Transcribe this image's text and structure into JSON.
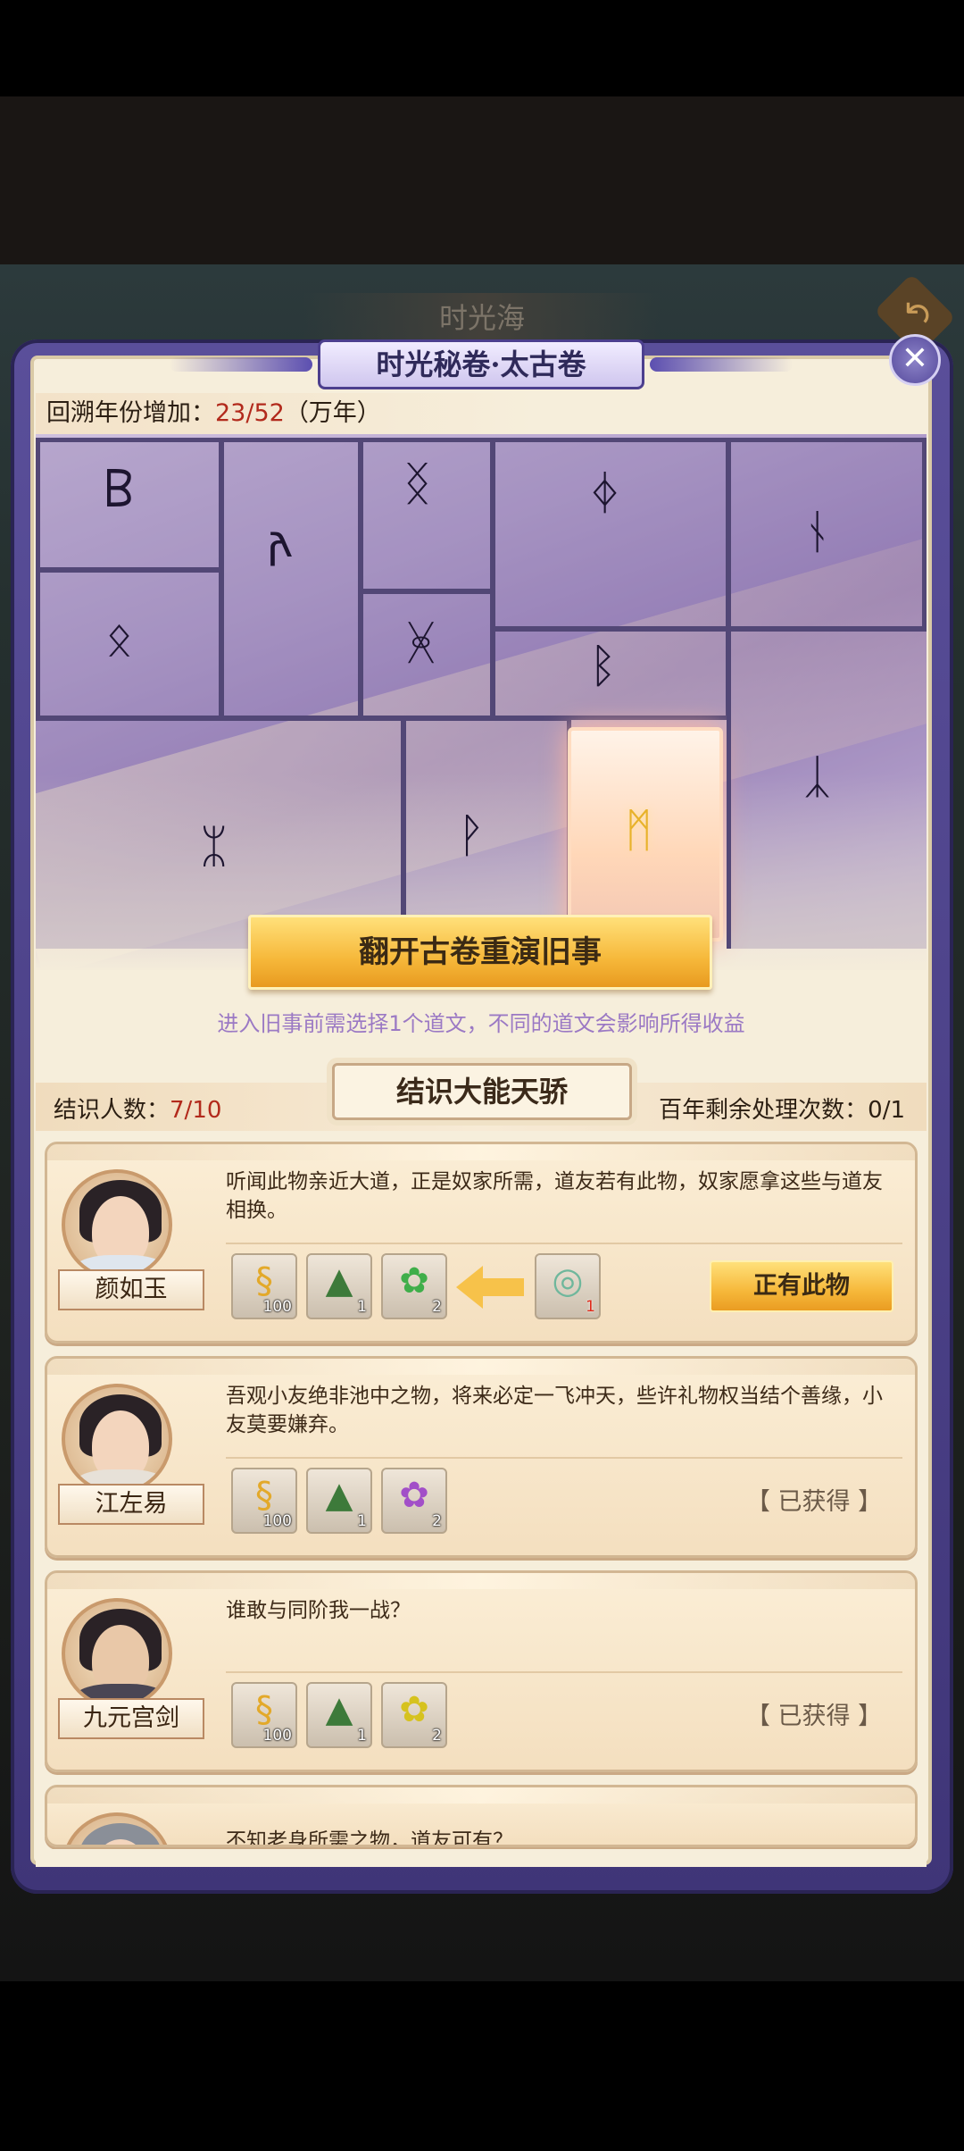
{
  "background": {
    "title": "时光海"
  },
  "panel": {
    "title": "时光秘卷·太古卷",
    "close_icon": "close-x-icon"
  },
  "scroll": {
    "years_label": "回溯年份增加：",
    "years_value": "23/52",
    "years_unit": "（万年）",
    "selected_tile_index": 10,
    "flip_button": "翻开古卷重演旧事",
    "hint": "进入旧事前需选择1个道文，不同的道文会影响所得收益"
  },
  "acquaint": {
    "title": "结识大能天骄",
    "meet_label": "结识人数：",
    "meet_value": "7/10",
    "remaining_label": "百年剩余处理次数：",
    "remaining_value": "0/1"
  },
  "cards": [
    {
      "name": "颜如玉",
      "quote": "听闻此物亲近大道，正是奴家所需，道友若有此物，奴家愿拿这些与道友相换。",
      "rewards": [
        {
          "icon": "gold-dragon-icon",
          "count": "100"
        },
        {
          "icon": "pagoda-icon",
          "count": "1"
        },
        {
          "icon": "green-lotus-icon",
          "count": "2"
        }
      ],
      "required": {
        "icon": "jade-orb-icon",
        "count": "1"
      },
      "action": "正有此物"
    },
    {
      "name": "江左易",
      "quote": "吾观小友绝非池中之物，将来必定一飞冲天，些许礼物权当结个善缘，小友莫要嫌弃。",
      "rewards": [
        {
          "icon": "gold-dragon-icon",
          "count": "100"
        },
        {
          "icon": "pagoda-icon",
          "count": "1"
        },
        {
          "icon": "purple-lotus-icon",
          "count": "2"
        }
      ],
      "status": "【 已获得 】"
    },
    {
      "name": "九元宫剑",
      "quote": "谁敢与同阶我一战？",
      "rewards": [
        {
          "icon": "gold-dragon-icon",
          "count": "100"
        },
        {
          "icon": "pagoda-icon",
          "count": "1"
        },
        {
          "icon": "yellow-lotus-icon",
          "count": "2"
        }
      ],
      "status": "【 已获得 】"
    },
    {
      "quote": "不知老身所需之物，道友可有？"
    }
  ],
  "colors": {
    "accent_red": "#b22a1c",
    "hint_purple": "#9b79c4",
    "gold_button": "#f6b83a",
    "frame_purple": "#4c3f8e"
  }
}
